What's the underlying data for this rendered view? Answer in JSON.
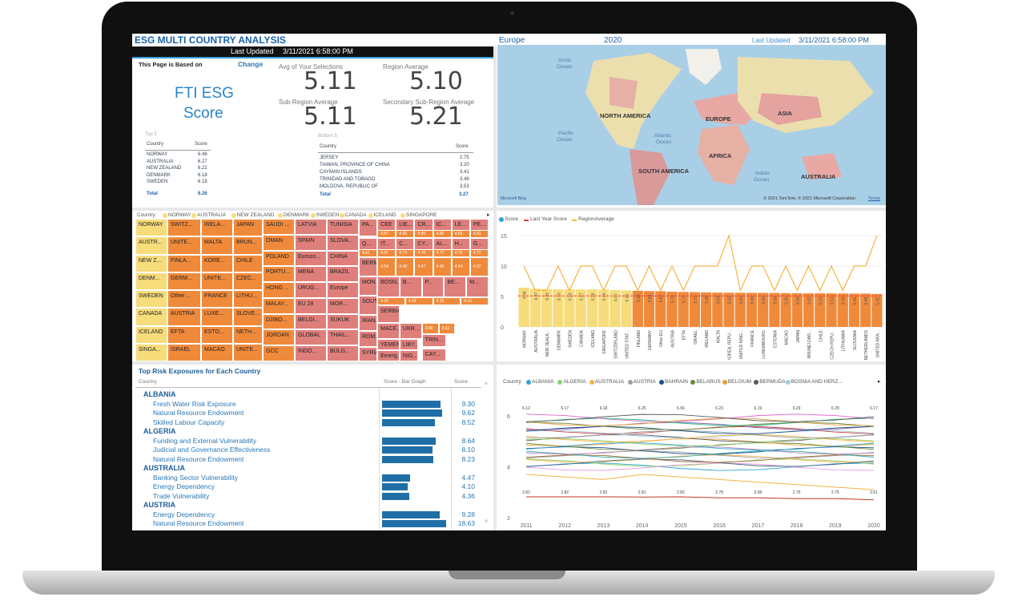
{
  "header": {
    "title": "ESG MULTI COUNTRY ANALYSIS",
    "updated_label": "Last Updated",
    "updated_value": "3/11/2021 6:58:00 PM",
    "region": "Europe",
    "year": "2020",
    "last_updated_right_label": "Last Updated",
    "last_updated_right_value": "3/11/2021 6:58:00 PM"
  },
  "based_on": {
    "label": "This Page is Based on",
    "change": "Change",
    "metric": "FTI ESG",
    "metric2": "Score"
  },
  "kpis": {
    "avg_label": "Avg of Your Selections",
    "avg_value": "5.11",
    "region_label": "Region Average",
    "region_value": "5.10",
    "subregion_label": "Sub-Region Average",
    "subregion_value": "5.11",
    "secondary_label": "Secondary Sub-Region Average",
    "secondary_value": "5.21"
  },
  "top5": {
    "title": "Top 5",
    "col1": "Country",
    "col2": "Score",
    "rows": [
      [
        "NORWAY",
        "6.46"
      ],
      [
        "AUSTRALIA",
        "6.27"
      ],
      [
        "NEW ZEALAND",
        "6.22"
      ],
      [
        "DENMARK",
        "6.18"
      ],
      [
        "SWEDEN",
        "6.18"
      ]
    ],
    "total_label": "Total",
    "total": "6.26"
  },
  "bottom5": {
    "title": "Bottom 5",
    "col1": "Country",
    "col2": "Score",
    "rows": [
      [
        "JERSEY",
        "2.75"
      ],
      [
        "TAIWAN, PROVINCE OF CHINA",
        "3.20"
      ],
      [
        "CAYMAN ISLANDS",
        "3.41"
      ],
      [
        "TRINIDAD AND TOBAGO",
        "3.46"
      ],
      [
        "MOLDOVA, REPUBLIC OF",
        "3.53"
      ]
    ],
    "total_label": "Total",
    "total": "3.27"
  },
  "map": {
    "labels": [
      "Arctic",
      "Ocean",
      "NORTH AMERICA",
      "EUROPE",
      "ASIA",
      "Pacific",
      "Ocean",
      "Atlantic",
      "Ocean",
      "AFRICA",
      "SOUTH AMERICA",
      "Indian",
      "Ocean",
      "AUSTRALIA"
    ],
    "attribution": "© 2021 TomTom, © 2021 Microsoft Corporation",
    "terms": "Terms",
    "bing": "Microsoft Bing"
  },
  "treemap": {
    "legend_label": "Country",
    "legend": [
      "NORWAY",
      "AUSTRALIA",
      "NEW ZEALAND",
      "DENMARK",
      "SWEDEN",
      "CANADA",
      "ICELAND",
      "SINGAPORE"
    ],
    "colors": {
      "yellow": "#f7dc7c",
      "orange": "#f08a3b",
      "red": "#df7f7c"
    },
    "col_yellow": [
      "NORWAY",
      "AUSTR...",
      "NEW Z...",
      "DENM...",
      "SWEDEN",
      "CANADA",
      "ICELAND",
      "SINGA..."
    ],
    "col2": [
      "SWITZ...",
      "UNITE...",
      "FINLA...",
      "GERM...",
      "Other ...",
      "AUSTRIA",
      "EFTA",
      "ISRAEL"
    ],
    "col3": [
      "IRELA...",
      "MALTA",
      "KORE...",
      "UNITE...",
      "FRANCE",
      "LUXE...",
      "ESTO...",
      "MACAO"
    ],
    "col4": [
      "JAPAN",
      "BRUN...",
      "CHILE",
      "CZEC...",
      "LITHU...",
      "SLOVE...",
      "NETH...",
      "UNITE..."
    ],
    "col5": [
      "SAUDI ...",
      "OMAN",
      "POLAND",
      "PORTU...",
      "HONG ...",
      "MALAY...",
      "DJIBO...",
      "JORDAN",
      "GCC"
    ],
    "col6": [
      "LATVIA",
      "SPAIN",
      "Eurozo...",
      "MENA",
      "URUG...",
      "EU 28",
      "BELGI...",
      "GLOBAL",
      "INDO..."
    ],
    "col7": [
      "TUNISIA",
      "SLOVA...",
      "CHINA",
      "BRAZIL",
      "Europe",
      "MOR...",
      "SUKUK",
      "THAIL...",
      "BULG..."
    ],
    "col8": [
      "PA...",
      "BERM...",
      "MON...",
      "SOUT...",
      "IRAN...",
      "ROM...",
      "SYRIA...",
      "Emerg..."
    ],
    "small": [
      "CEE",
      "LIE...",
      "CR...",
      "IC...",
      "LE...",
      "PE...",
      "4.87",
      "4.85",
      "4.85",
      "4.85",
      "4.83",
      "4.81",
      "Q...",
      "IT...",
      "C...",
      "CY...",
      "AL...",
      "H...",
      "G...",
      "4.81",
      "4.81",
      "4.79",
      "4.78",
      "4.77",
      "4.76",
      "4.72",
      "4.54",
      "4.48",
      "4.47",
      "4.46",
      "4.44",
      "4.37",
      "BOSN...",
      "B...",
      "P...",
      "BE...",
      "M...",
      "4.20",
      "4.19",
      "4.15",
      "4.13",
      "SERBIA",
      "MACE...",
      "UKR...",
      "3.88",
      "3.82",
      "YEMEN",
      "LIBY...",
      "TRIN...",
      "NIG...",
      "CAY..."
    ]
  },
  "bar_chart": {
    "legend": [
      "Score",
      "Last Year Score",
      "RegionAverage"
    ],
    "colors": {
      "yellow": "#f7dc7c",
      "orange": "#f08a3b",
      "line": "#f5b342",
      "avg": "#e23c3c",
      "legend_dot": "#32a4d8"
    },
    "yticks": [
      "15",
      "10",
      "5",
      "0"
    ],
    "categories": [
      "NORWAY",
      "AUSTRALIA",
      "NEW ZEALA...",
      "DENMARK",
      "SWEDEN",
      "CANADA",
      "ICELAND",
      "SINGAPORE",
      "SWITZERLAND",
      "UNITED STAT...",
      "FINLAND",
      "GERMANY",
      "Other EU",
      "AUSTRIA",
      "EFTA",
      "ISRAEL",
      "IRELAND",
      "MALTA",
      "KOREA, REPU...",
      "UNITED KING...",
      "FRANCE",
      "LUXEMBOURG",
      "ESTONIA",
      "MACAO",
      "JAPAN",
      "BRUNEI DAR...",
      "CHILE",
      "CZECH REPU...",
      "LITHUANIA",
      "SLOVENIA",
      "NETHERLANDS",
      "UNITED ARA..."
    ],
    "values": [
      "6.46",
      "6.27",
      "6.22",
      "6.18",
      "6.18",
      "6.17",
      "6.16",
      "6.15",
      "6.07",
      "6.00",
      "5.94",
      "5.89",
      "5.87",
      "5.78",
      "5.74",
      "5.72",
      "5.68",
      "5.64",
      "5.62",
      "5.61",
      "5.60",
      "5.60",
      "5.58",
      "5.55",
      "5.54",
      "5.52",
      "5.52",
      "5.51",
      "5.50",
      "5.48",
      "5.48",
      "5.42"
    ],
    "value_nums": [
      6.46,
      6.27,
      6.22,
      6.18,
      6.18,
      6.17,
      6.16,
      6.15,
      6.07,
      6.0,
      5.94,
      5.89,
      5.87,
      5.78,
      5.74,
      5.72,
      5.68,
      5.64,
      5.62,
      5.61,
      5.6,
      5.6,
      5.58,
      5.55,
      5.54,
      5.52,
      5.52,
      5.51,
      5.5,
      5.48,
      5.48,
      5.42
    ],
    "last_year": [
      10,
      6,
      6,
      10,
      6,
      10,
      10,
      6,
      10,
      10,
      6,
      10,
      6,
      10,
      6,
      10,
      10,
      10,
      15,
      6,
      10,
      10,
      6,
      10,
      6,
      10,
      6,
      10,
      6,
      10,
      10,
      15
    ],
    "region_avg": 5.1,
    "ymax": 15,
    "highlight_count": 10
  },
  "risk": {
    "title": "Top Risk Exposures for Each Country",
    "col1": "Country",
    "col2": "Score - Bar Graph",
    "col3": "Score",
    "groups": [
      {
        "country": "ALBANIA",
        "items": [
          [
            "Fresh Water Risk Exposure",
            "9.30"
          ],
          [
            "Natural Resource Endowment",
            "9.62"
          ],
          [
            "Skilled Labour Capacity",
            "8.52"
          ]
        ]
      },
      {
        "country": "ALGERIA",
        "items": [
          [
            "Funding and External Vulnerability",
            "8.64"
          ],
          [
            "Judicial and Governance Effectiveness",
            "8.10"
          ],
          [
            "Natural Resource Endowment",
            "8.23"
          ]
        ]
      },
      {
        "country": "AUSTRALIA",
        "items": [
          [
            "Banking Sector Vulnerability",
            "4.47"
          ],
          [
            "Energy Dependency",
            "4.10"
          ],
          [
            "Trade Vulnerability",
            "4.36"
          ]
        ]
      },
      {
        "country": "AUSTRIA",
        "items": [
          [
            "Energy Dependency",
            "9.28"
          ],
          [
            "Natural Resource Endowment",
            "18.63"
          ]
        ]
      }
    ]
  },
  "line_chart": {
    "legend_label": "Country",
    "legend": [
      "ALBANIA",
      "ALGERIA",
      "AUSTRALIA",
      "AUSTRIA",
      "BAHRAIN",
      "BELARUS",
      "BELGIUM",
      "BERMUDA",
      "BOSNIA AND HERZ..."
    ],
    "legend_colors": [
      "#32a4d8",
      "#8fd16a",
      "#f5b342",
      "#9aa3a8",
      "#1b4f8a",
      "#6a8a3a",
      "#e8a23a",
      "#5a5a5a",
      "#9ecbe8"
    ],
    "x": [
      "2011",
      "2012",
      "2013",
      "2014",
      "2015",
      "2016",
      "2017",
      "2018",
      "2019",
      "2020"
    ],
    "yticks": [
      "6",
      "4",
      "2"
    ],
    "labels_top": [
      "6.12",
      "6.17",
      "6.18",
      "6.25",
      "6.06",
      "6.23",
      "6.19",
      "6.29",
      "6.29",
      "6.17"
    ],
    "labels_low": [
      "2.82",
      "2.82",
      "2.82",
      "2.81",
      "2.82",
      "2.78",
      "3.38",
      "2.75",
      "2.75",
      "2.61"
    ]
  }
}
